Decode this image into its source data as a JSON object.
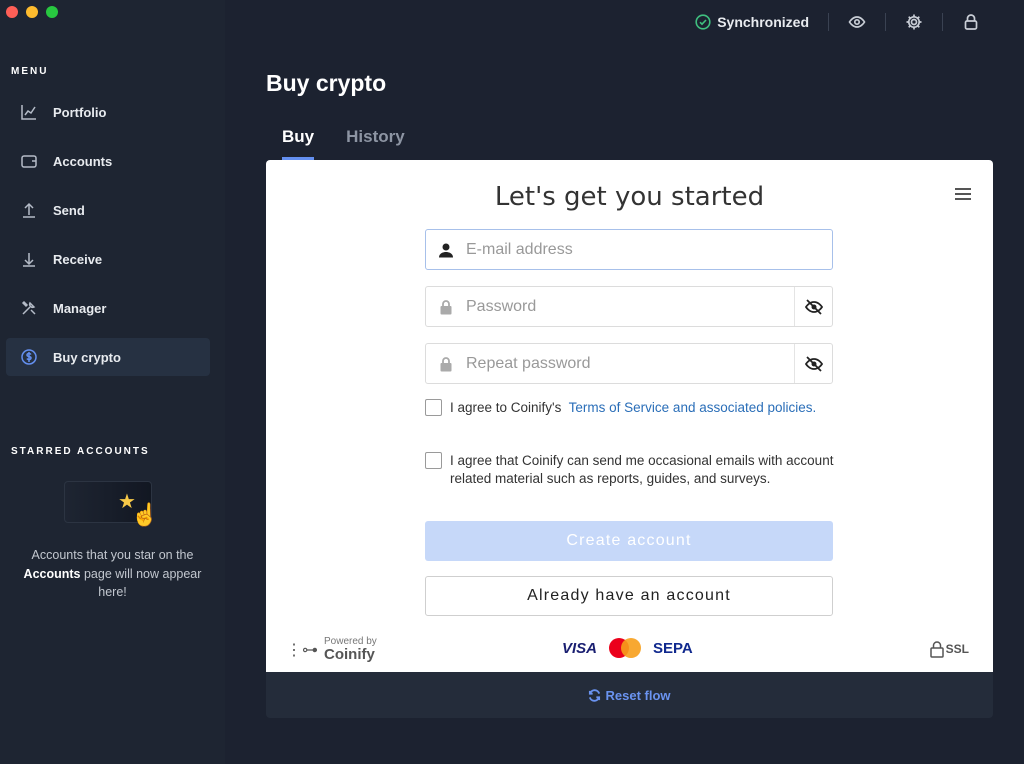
{
  "topbar": {
    "sync_status": "Synchronized"
  },
  "sidebar": {
    "menu_title": "MENU",
    "items": [
      {
        "label": "Portfolio",
        "icon": "chart-icon"
      },
      {
        "label": "Accounts",
        "icon": "wallet-icon"
      },
      {
        "label": "Send",
        "icon": "upload-icon"
      },
      {
        "label": "Receive",
        "icon": "download-icon"
      },
      {
        "label": "Manager",
        "icon": "tools-icon"
      },
      {
        "label": "Buy crypto",
        "icon": "dollar-icon",
        "active": true
      }
    ],
    "starred_title": "STARRED ACCOUNTS",
    "starred_text_1": "Accounts that you star on the",
    "starred_text_bold": "Accounts",
    "starred_text_2": "page will now appear here!"
  },
  "main": {
    "title": "Buy crypto",
    "tabs": [
      {
        "label": "Buy",
        "active": true
      },
      {
        "label": "History",
        "active": false
      }
    ]
  },
  "form": {
    "title": "Let's get you started",
    "email_placeholder": "E-mail address",
    "password_placeholder": "Password",
    "repeat_password_placeholder": "Repeat password",
    "terms_prefix": "I agree to Coinify's",
    "terms_link": "Terms of Service and associated policies.",
    "emails_consent": "I agree that Coinify can send me occasional emails with account related material such as reports, guides, and surveys.",
    "create_button": "Create account",
    "login_button": "Already have an account"
  },
  "footer": {
    "powered_by": "Powered by",
    "provider": "Coinify",
    "payment_methods": [
      "VISA",
      "SEPA"
    ],
    "ssl_label": "SSL"
  },
  "reset": {
    "label": "Reset flow"
  },
  "colors": {
    "accent": "#6490f1",
    "sync": "#3fbf7f",
    "button_disabled": "#c6d8f9"
  }
}
